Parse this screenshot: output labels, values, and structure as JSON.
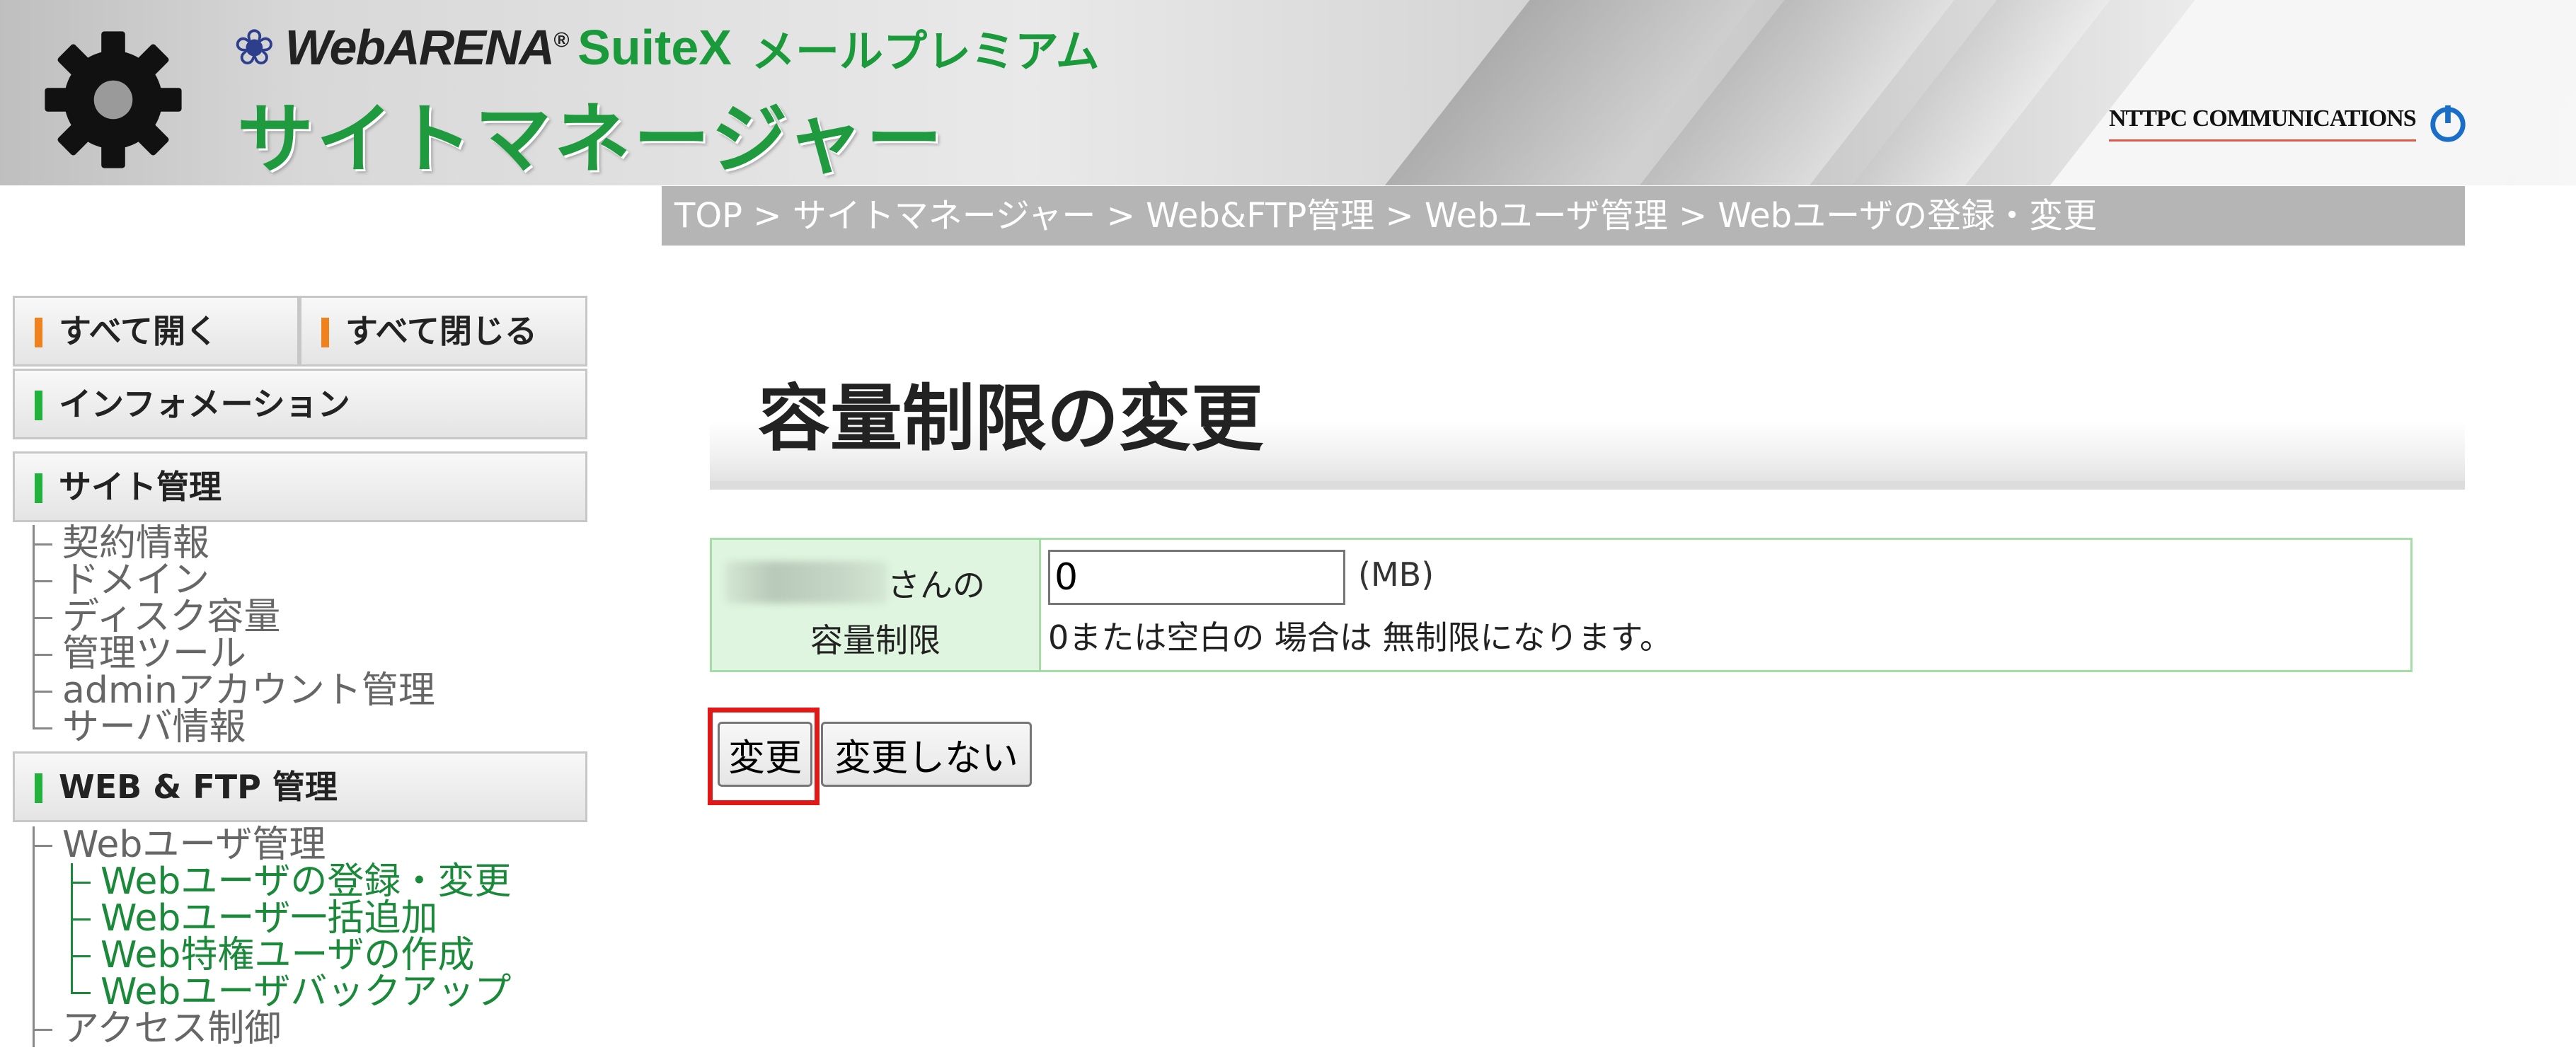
{
  "header": {
    "brand_webarena": "WebARENA",
    "brand_registered": "®",
    "brand_suitex": "SuiteX",
    "brand_product": "メールプレミアム",
    "site_title": "サイトマネージャー",
    "ntt_logo": "NTTPC COMMUNICATIONS",
    "icons": [
      "gear-icon",
      "ntt-power-icon"
    ],
    "accent_green": "#1f9a3e",
    "accent_navy": "#2c3e8c"
  },
  "breadcrumb": {
    "text": "TOP > サイトマネージャー > Web&FTP管理 > Webユーザ管理 > Webユーザの登録・変更"
  },
  "sidebar": {
    "open_all": "すべて開く",
    "close_all": "すべて閉じる",
    "information": "インフォメーション",
    "site_management": "サイト管理",
    "site_items": [
      "契約情報",
      "ドメイン",
      "ディスク容量",
      "管理ツール",
      "adminアカウント管理",
      "サーバ情報"
    ],
    "web_ftp": "WEB & FTP 管理",
    "web_user_mgmt": "Webユーザ管理",
    "web_user_subitems": [
      "Webユーザの登録・変更",
      "Webユーザ一括追加",
      "Web特権ユーザの作成",
      "Webユーザバックアップ"
    ],
    "access_control": "アクセス制御",
    "bar_orange": "#f0821e",
    "bar_green": "#20b23a"
  },
  "main": {
    "page_title": "容量制限の変更",
    "form": {
      "label_line1": "さんの",
      "label_line2": "容量制限",
      "quota_value": "0",
      "unit": "(MB)",
      "help": "0または空白の 場合は 無制限になります。"
    },
    "buttons": {
      "change": "変更",
      "no_change": "変更しない"
    },
    "highlight_color": "#e01818"
  }
}
